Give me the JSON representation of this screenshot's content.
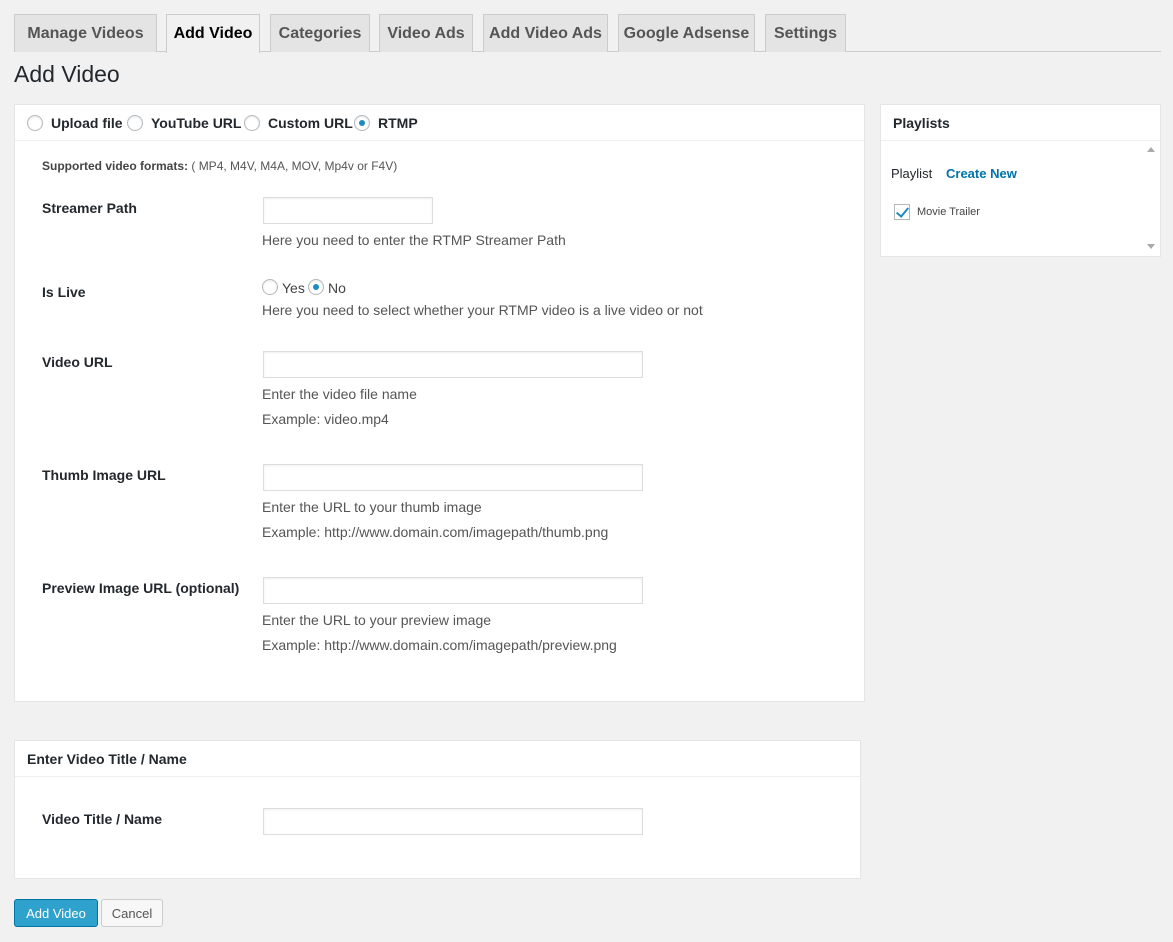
{
  "tabs": [
    "Manage Videos",
    "Add Video",
    "Categories",
    "Video Ads",
    "Add Video Ads",
    "Google Adsense",
    "Settings"
  ],
  "page_title": "Add Video",
  "source": {
    "options": [
      "Upload file",
      "YouTube URL",
      "Custom URL",
      "RTMP"
    ],
    "selected": "RTMP"
  },
  "supported": {
    "label": "Supported video formats:",
    "formats": "( MP4, M4V, M4A, MOV, Mp4v or F4V)"
  },
  "form": {
    "streamer_label": "Streamer Path",
    "streamer_desc": "Here you need to enter the RTMP Streamer Path",
    "islive_label": "Is Live",
    "islive_yes": "Yes",
    "islive_no": "No",
    "islive_selected": "No",
    "islive_desc": "Here you need to select whether your RTMP video is a live video or not",
    "videourl_label": "Video URL",
    "videourl_desc": "Enter the video file name",
    "videourl_example": "Example: video.mp4",
    "thumb_label": "Thumb Image URL",
    "thumb_desc": "Enter the URL to your thumb image",
    "thumb_example": "Example: http://www.domain.com/imagepath/thumb.png",
    "preview_label": "Preview Image URL (optional)",
    "preview_desc": "Enter the URL to your preview image",
    "preview_example": "Example: http://www.domain.com/imagepath/preview.png"
  },
  "title_box": {
    "header": "Enter Video Title / Name",
    "label": "Video Title / Name"
  },
  "playlists": {
    "header": "Playlists",
    "label": "Playlist",
    "create_new": "Create New",
    "items": [
      {
        "name": "Movie Trailer",
        "checked": true
      }
    ]
  },
  "buttons": {
    "add": "Add Video",
    "cancel": "Cancel"
  },
  "colors": {
    "accent": "#2ea2cc",
    "link": "#0073aa",
    "page_bg": "#f1f1f1"
  }
}
